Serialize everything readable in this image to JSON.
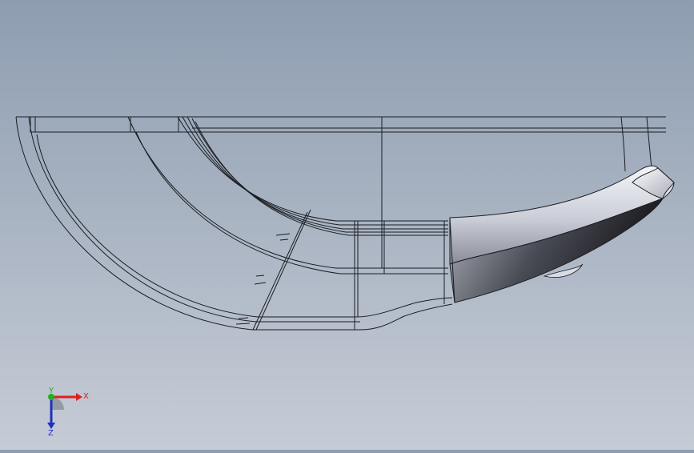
{
  "viewport": {
    "background_top": "#8e9db1",
    "background_bottom": "#c6ccd6",
    "wire_color": "#1a1d22"
  },
  "triad": {
    "x_label": "X",
    "y_label": "Y",
    "z_label": "Z",
    "x_color": "#e02020",
    "y_color": "#22b022",
    "z_color": "#2030c0"
  }
}
